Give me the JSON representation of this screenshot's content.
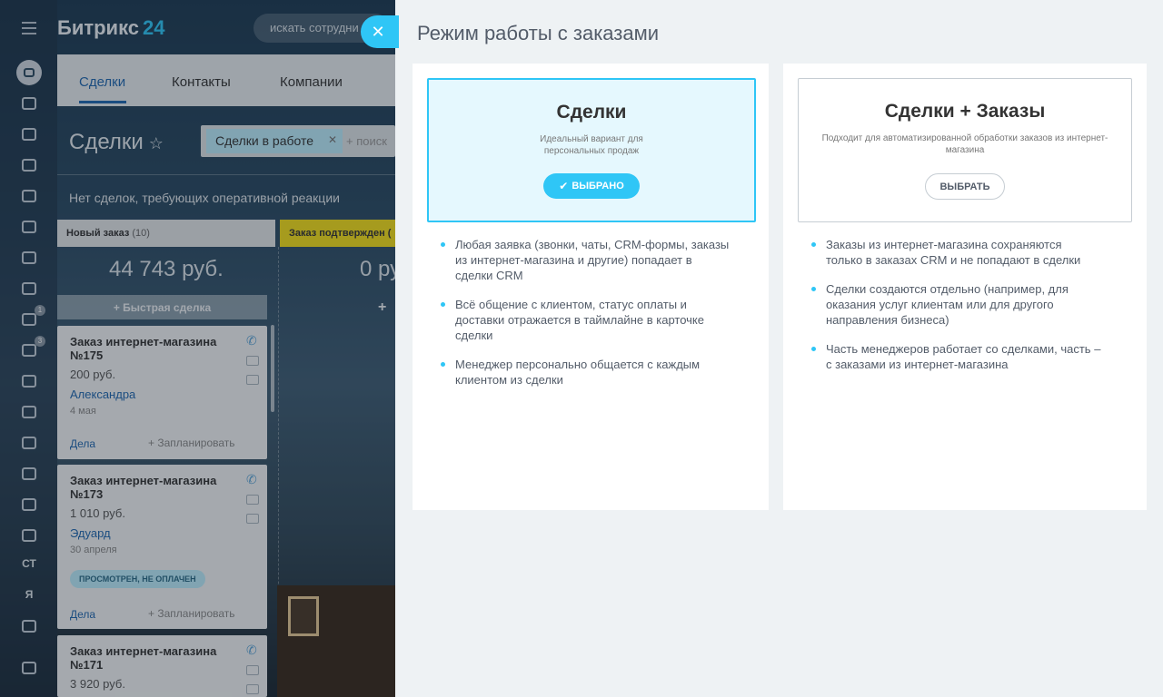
{
  "app": {
    "logo": "Битрикс",
    "logo_num": "24",
    "search_placeholder": "искать сотрудни"
  },
  "leftnav": {
    "badges": [
      "1",
      "3"
    ],
    "texts": [
      "СТ",
      "Я"
    ]
  },
  "tabs": [
    "Сделки",
    "Контакты",
    "Компании"
  ],
  "crm": {
    "title": "Сделки",
    "filter_chip": "Сделки в работе",
    "filter_more": "+ поиск",
    "notice": "Нет сделок, требующих оперативной реакции",
    "stages": [
      {
        "name": "Новый заказ",
        "count": "(10)",
        "sum": "44 743 руб."
      },
      {
        "name": "Заказ подтвержден (",
        "count": "",
        "sum": "0 ру"
      }
    ],
    "quick_deal": "Быстрая сделка",
    "cards": [
      {
        "name": "Заказ интернет-магазина №175",
        "price": "200 руб.",
        "person": "Александра",
        "date": "4 мая",
        "tag": "",
        "deals": "Дела",
        "plan": "+ Запланировать"
      },
      {
        "name": "Заказ интернет-магазина №173",
        "price": "1 010 руб.",
        "person": "Эдуард",
        "date": "30 апреля",
        "tag": "ПРОСМОТРЕН, НЕ ОПЛАЧЕН",
        "deals": "Дела",
        "plan": "+ Запланировать"
      },
      {
        "name": "Заказ интернет-магазина №171",
        "price": "3 920 руб.",
        "person": "",
        "date": "",
        "tag": "",
        "deals": "",
        "plan": ""
      }
    ]
  },
  "panel": {
    "title": "Режим работы с заказами",
    "options": [
      {
        "title": "Сделки",
        "subtitle": "Идеальный вариант для персональных продаж",
        "button": "ВЫБРАНО",
        "features": [
          "Любая заявка (звонки, чаты, CRM-формы, заказы из интернет-магазина и другие) попадает в сделки CRM",
          "Всё общение с клиентом, статус оплаты и доставки отражается в таймлайне в карточке сделки",
          "Менеджер персонально общается с каждым клиентом из сделки"
        ]
      },
      {
        "title": "Сделки + Заказы",
        "subtitle": "Подходит для автоматизированной обработки заказов из интернет-магазина",
        "button": "ВЫБРАТЬ",
        "features": [
          "Заказы из интернет-магазина сохраняются только в заказах CRM и не попадают в сделки",
          "Сделки создаются отдельно (например, для оказания услуг клиентам или для другого направления бизнеса)",
          "Часть менеджеров работает со сделками, часть – с заказами из интернет-магазина"
        ]
      }
    ]
  }
}
